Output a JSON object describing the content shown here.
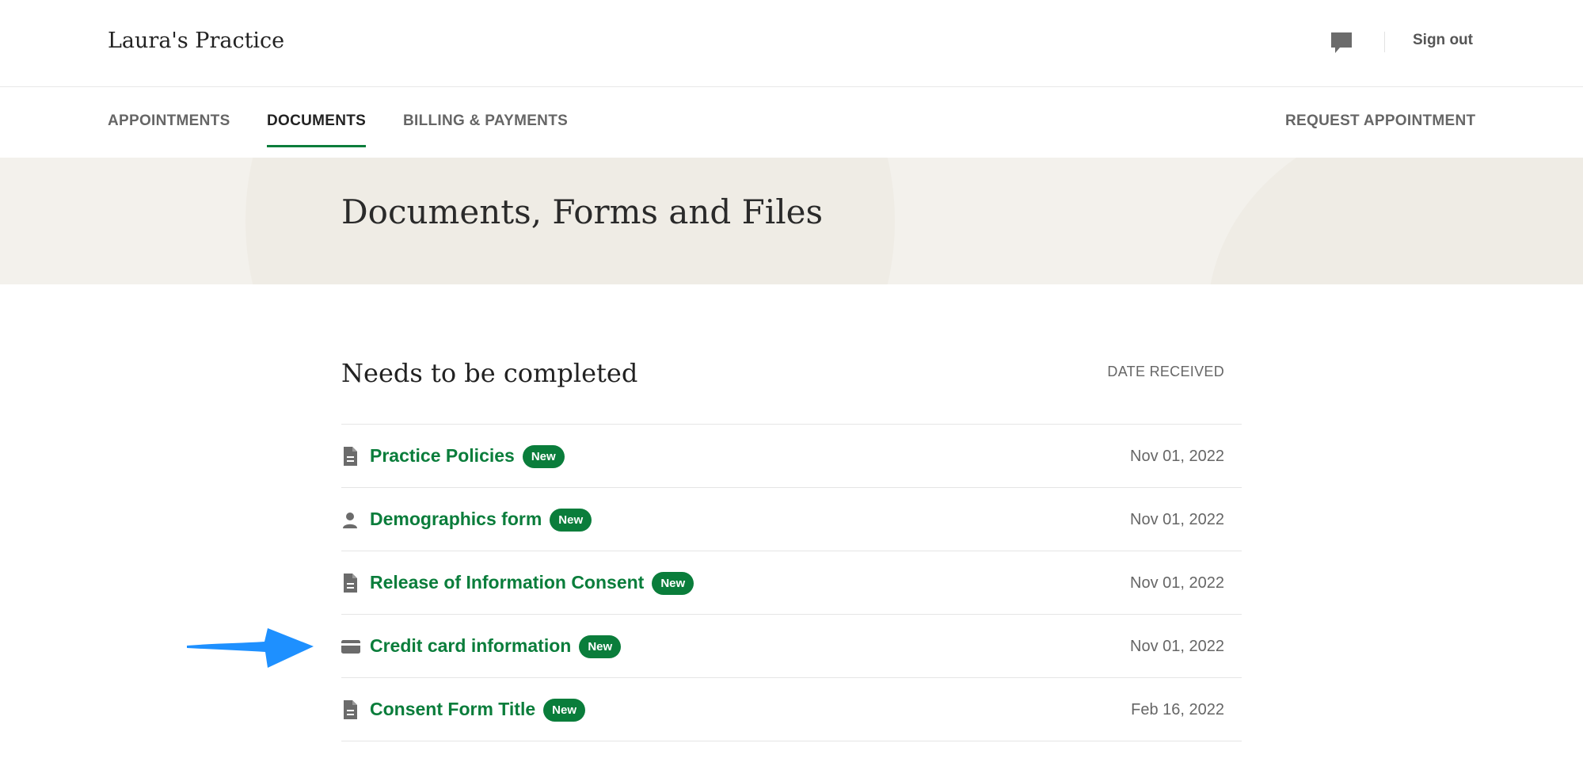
{
  "header": {
    "brand": "Laura's Practice",
    "chat_icon": "chat-bubble-icon",
    "sign_out": "Sign out"
  },
  "nav": {
    "items": [
      {
        "label": "APPOINTMENTS",
        "active": false
      },
      {
        "label": "DOCUMENTS",
        "active": true
      },
      {
        "label": "BILLING & PAYMENTS",
        "active": false
      }
    ],
    "request_appointment": "REQUEST APPOINTMENT"
  },
  "hero": {
    "title": "Documents, Forms and Files"
  },
  "section": {
    "title": "Needs to be completed",
    "date_header": "DATE RECEIVED"
  },
  "documents": [
    {
      "icon": "document-icon",
      "title": "Practice Policies",
      "badge": "New",
      "date": "Nov 01, 2022"
    },
    {
      "icon": "person-icon",
      "title": "Demographics form",
      "badge": "New",
      "date": "Nov 01, 2022"
    },
    {
      "icon": "document-icon",
      "title": "Release of Information Consent",
      "badge": "New",
      "date": "Nov 01, 2022"
    },
    {
      "icon": "credit-card-icon",
      "title": "Credit card information",
      "badge": "New",
      "date": "Nov 01, 2022"
    },
    {
      "icon": "document-icon",
      "title": "Consent Form Title",
      "badge": "New",
      "date": "Feb 16, 2022"
    }
  ],
  "colors": {
    "accent": "#0a7d3b",
    "hero_bg": "#f3f1ec",
    "annotation_arrow": "#1e90ff"
  }
}
